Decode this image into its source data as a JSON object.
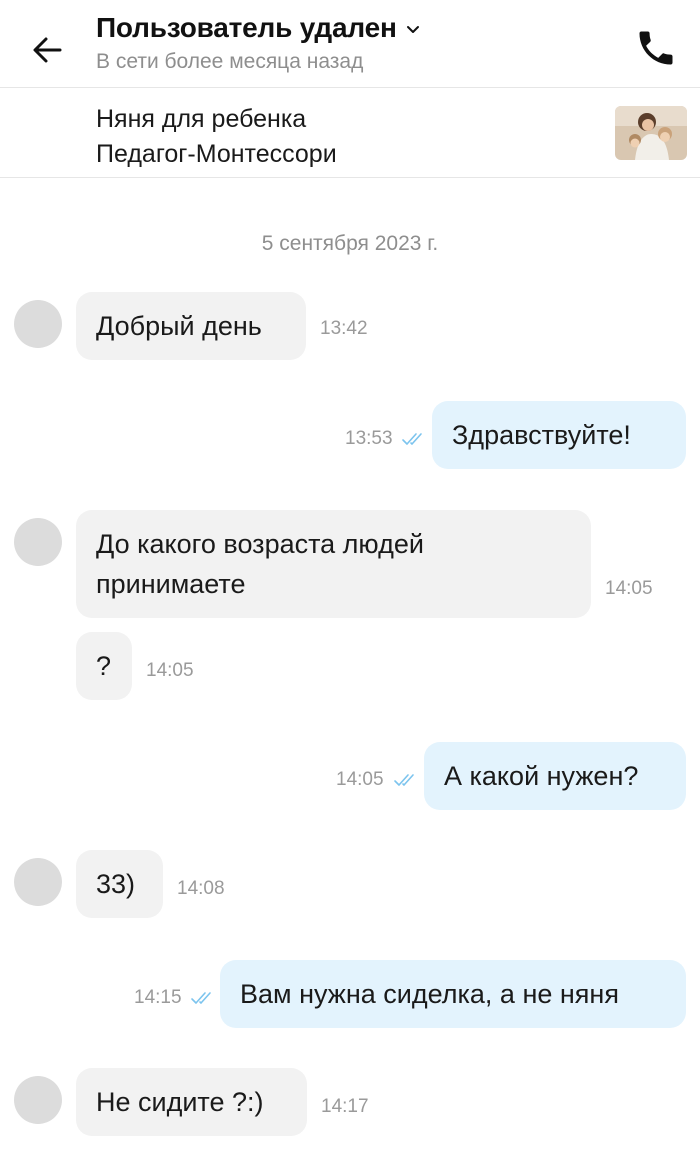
{
  "header": {
    "title": "Пользователь удален",
    "status": "В сети более месяца назад"
  },
  "listing": {
    "line1": "Няня для ребенка",
    "line2": "Педагог-Монтессори"
  },
  "date_separator": "5 сентября 2023 г.",
  "messages": [
    {
      "direction": "in",
      "text": "Добрый день",
      "time": "13:42"
    },
    {
      "direction": "out",
      "text": "Здравствуйте!",
      "time": "13:53",
      "status": "read"
    },
    {
      "direction": "in",
      "text": "До какого возраста людей принимаете",
      "time": "14:05"
    },
    {
      "direction": "in",
      "text": "?",
      "time": "14:05"
    },
    {
      "direction": "out",
      "text": "А какой нужен?",
      "time": "14:05",
      "status": "read"
    },
    {
      "direction": "in",
      "text": "33)",
      "time": "14:08"
    },
    {
      "direction": "out",
      "text": "Вам нужна сиделка, а не няня",
      "time": "14:15",
      "status": "read"
    },
    {
      "direction": "in",
      "text": "Не сидите ?:)",
      "time": "14:17"
    }
  ],
  "colors": {
    "incoming_bubble": "#f2f2f2",
    "outgoing_bubble": "#e3f3fd",
    "read_check": "#7cc4ee",
    "secondary_text": "#8e8e8e"
  },
  "icons": {
    "back": "arrow-left-icon",
    "call": "phone-icon",
    "title_dropdown": "chevron-down-icon",
    "read_status": "double-check-icon"
  }
}
